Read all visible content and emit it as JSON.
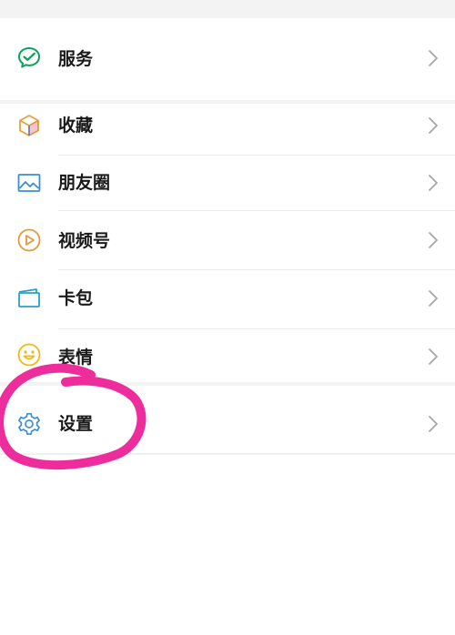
{
  "menu": {
    "items": [
      {
        "label": "服务",
        "icon": "wechat-pay-icon",
        "color": "#07a35a"
      },
      {
        "label": "收藏",
        "icon": "cube-icon",
        "color": "#e7a33a"
      },
      {
        "label": "朋友圈",
        "icon": "picture-icon",
        "color": "#3a8fd6"
      },
      {
        "label": "视频号",
        "icon": "play-circle-icon",
        "color": "#e29a3a"
      },
      {
        "label": "卡包",
        "icon": "card-icon",
        "color": "#2aa0c9"
      },
      {
        "label": "表情",
        "icon": "smiley-icon",
        "color": "#f0b915"
      },
      {
        "label": "设置",
        "icon": "gear-icon",
        "color": "#3a8fd6"
      }
    ]
  },
  "colors": {
    "annotation": "#ee2d9c",
    "chevron": "#a6a6a6",
    "background": "#ffffff",
    "separator": "#f3f3f3"
  }
}
